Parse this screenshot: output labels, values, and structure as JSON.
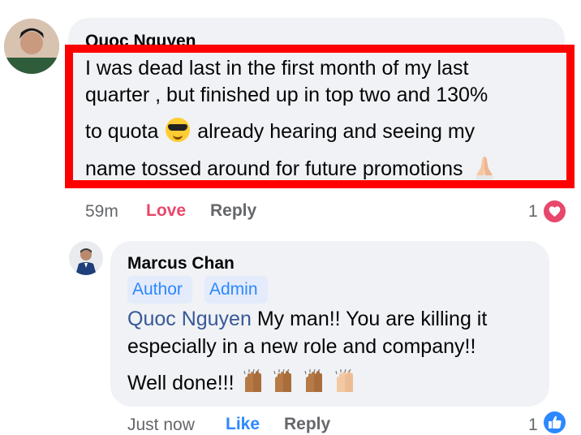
{
  "comments": [
    {
      "author": "Quoc Nguyen",
      "lines": [
        "I was dead last in the first month of my last",
        "quarter , but finished up in top two and 130%",
        "to quota",
        "already hearing and seeing my",
        "name tossed around for future promotions"
      ],
      "time": "59m",
      "reaction_label": "Love",
      "reply_label": "Reply",
      "reaction_count": "1",
      "reaction_icon": "heart-icon"
    },
    {
      "author": "Marcus Chan",
      "badges": [
        "Author",
        "Admin"
      ],
      "mention": "Quoc Nguyen",
      "lines": [
        "My man!!  You are killing it",
        "especially in a new role and company!!",
        "Well done!!!"
      ],
      "time": "Just now",
      "reaction_label": "Like",
      "reply_label": "Reply",
      "reaction_count": "1",
      "reaction_icon": "thumbs-up-icon"
    }
  ],
  "colors": {
    "bubble": "#f0f2f5",
    "highlight": "#ff0000",
    "love": "#e8476b",
    "like": "#2d88ff"
  }
}
